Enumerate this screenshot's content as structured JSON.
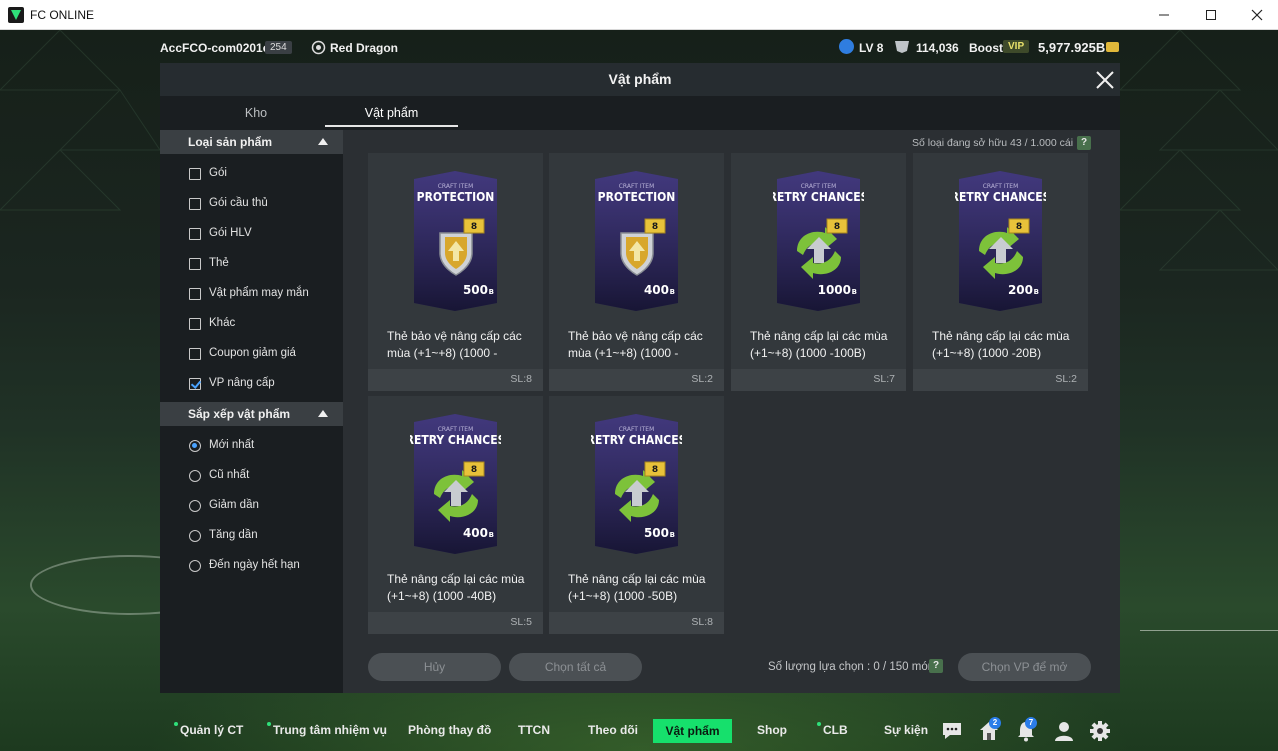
{
  "window": {
    "title": "FC ONLINE"
  },
  "topbar": {
    "account_name": "AccFCO-com0201c",
    "account_id": "254",
    "team_name": "Red Dragon",
    "level": "LV 8",
    "coins": "114,036",
    "boost_label": "Boost",
    "vip_label": "VIP",
    "bp": "5,977.925B"
  },
  "modal": {
    "title": "Vật phẩm",
    "tabs": [
      {
        "label": "Kho"
      },
      {
        "label": "Vật phẩm"
      }
    ],
    "owned_text": "Số loại đang sở hữu  43 / 1.000 cái",
    "help_label": "?",
    "selected_count_text": "Số lượng lựa chọn : 0 / 150 món",
    "cancel_label": "Hủy",
    "select_all_label": "Chọn tất cả",
    "open_selected_label": "Chọn VP để mở"
  },
  "filters": {
    "product_type": {
      "title": "Loại sản phẩm",
      "options": [
        {
          "label": "Gói",
          "checked": false
        },
        {
          "label": "Gói cầu thủ",
          "checked": false
        },
        {
          "label": "Gói HLV",
          "checked": false
        },
        {
          "label": "Thẻ",
          "checked": false
        },
        {
          "label": "Vật phẩm may mắn",
          "checked": false
        },
        {
          "label": "Khác",
          "checked": false
        },
        {
          "label": "Coupon giảm giá",
          "checked": false
        },
        {
          "label": "VP nâng cấp",
          "checked": true
        }
      ]
    },
    "sort": {
      "title": "Sắp xếp vật phẩm",
      "options": [
        {
          "label": "Mới nhất",
          "selected": true
        },
        {
          "label": "Cũ nhất",
          "selected": false
        },
        {
          "label": "Giảm dần",
          "selected": false
        },
        {
          "label": "Tăng dần",
          "selected": false
        },
        {
          "label": "Đến ngày hết hạn",
          "selected": false
        }
      ]
    }
  },
  "items": [
    {
      "type": "PROTECTION",
      "craft_label": "CRAFT ITEM",
      "price": "500",
      "price_unit": "B",
      "level": "8",
      "name": "Thẻ bảo vệ nâng cấp các mùa (+1~+8) (1000 -",
      "qty": "SL:8",
      "card_color": "#2e2a5e"
    },
    {
      "type": "PROTECTION",
      "craft_label": "CRAFT ITEM",
      "price": "400",
      "price_unit": "B",
      "level": "8",
      "name": "Thẻ bảo vệ nâng cấp các mùa (+1~+8) (1000 -",
      "qty": "SL:2",
      "card_color": "#2e2a5e"
    },
    {
      "type": "RETRY CHANCES",
      "craft_label": "CRAFT ITEM",
      "price": "1000",
      "price_unit": "B",
      "level": "8",
      "name": "Thẻ nâng cấp lại các mùa (+1~+8) (1000 -100B)",
      "qty": "SL:7",
      "card_color": "#2e2a5e"
    },
    {
      "type": "RETRY CHANCES",
      "craft_label": "CRAFT ITEM",
      "price": "200",
      "price_unit": "B",
      "level": "8",
      "name": "Thẻ nâng cấp lại các mùa (+1~+8) (1000 -20B)",
      "qty": "SL:2",
      "card_color": "#2e2a5e"
    },
    {
      "type": "RETRY CHANCES",
      "craft_label": "CRAFT ITEM",
      "price": "400",
      "price_unit": "B",
      "level": "8",
      "name": "Thẻ nâng cấp lại các mùa (+1~+8) (1000 -40B)",
      "qty": "SL:5",
      "card_color": "#2e2a5e"
    },
    {
      "type": "RETRY CHANCES",
      "craft_label": "CRAFT ITEM",
      "price": "500",
      "price_unit": "B",
      "level": "8",
      "name": "Thẻ nâng cấp lại các mùa (+1~+8) (1000 -50B)",
      "qty": "SL:8",
      "card_color": "#2e2a5e"
    }
  ],
  "nav": {
    "items": [
      {
        "label": "Quản lý CT"
      },
      {
        "label": "Trung tâm nhiệm vụ"
      },
      {
        "label": "Phòng thay đồ"
      },
      {
        "label": "TTCN"
      },
      {
        "label": "Theo dõi"
      },
      {
        "label": "Vật phẩm"
      },
      {
        "label": "Shop"
      },
      {
        "label": "CLB"
      },
      {
        "label": "Sự kiện"
      }
    ],
    "mail_badge": "2",
    "notify_badge": "7"
  },
  "colors": {
    "accent_green": "#16e06c",
    "check_blue": "#4aa3ff"
  }
}
